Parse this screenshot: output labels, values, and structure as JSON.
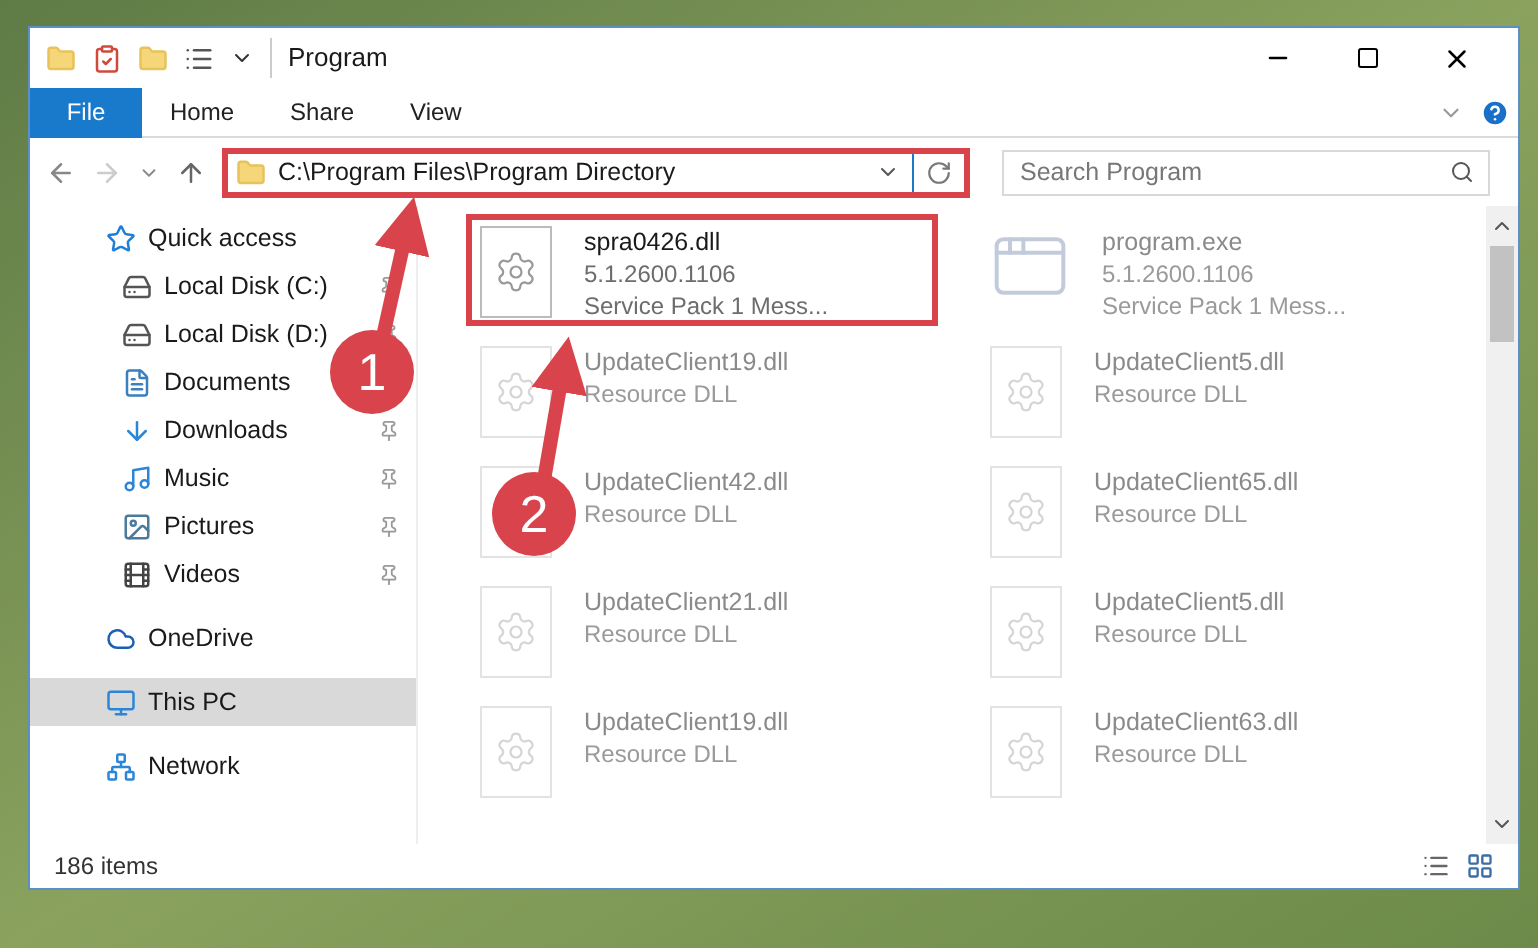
{
  "window": {
    "title": "Program"
  },
  "ribbon_tabs": [
    {
      "label": "File",
      "selected": true
    },
    {
      "label": "Home",
      "selected": false
    },
    {
      "label": "Share",
      "selected": false
    },
    {
      "label": "View",
      "selected": false
    }
  ],
  "address_bar": {
    "path": "C:\\Program Files\\Program Directory",
    "highlighted": true
  },
  "search": {
    "placeholder": "Search Program"
  },
  "navigation": [
    {
      "label": "Quick access",
      "kind": "star",
      "selected": false,
      "children": [
        {
          "label": "Local Disk (C:)",
          "kind": "drive-c",
          "pinned": true
        },
        {
          "label": "Local Disk (D:)",
          "kind": "drive",
          "pinned": true
        },
        {
          "label": "Documents",
          "kind": "documents"
        },
        {
          "label": "Downloads",
          "kind": "downloads",
          "pinned": true
        },
        {
          "label": "Music",
          "kind": "music",
          "pinned": true
        },
        {
          "label": "Pictures",
          "kind": "pictures",
          "pinned": true
        },
        {
          "label": "Videos",
          "kind": "videos",
          "pinned": true
        }
      ]
    },
    {
      "label": "OneDrive",
      "kind": "cloud",
      "selected": false
    },
    {
      "label": "This PC",
      "kind": "pc",
      "selected": true
    },
    {
      "label": "Network",
      "kind": "network",
      "selected": false
    }
  ],
  "files": [
    {
      "name": "spra0426.dll",
      "kind": "dll",
      "faded": false,
      "highlighted": true,
      "details": [
        "5.1.2600.1106",
        "Service Pack 1 Mess..."
      ]
    },
    {
      "name": "program.exe",
      "kind": "exe",
      "faded": true,
      "highlighted": false,
      "details": [
        "5.1.2600.1106",
        "Service Pack 1 Mess..."
      ]
    },
    {
      "name": "UpdateClient19.dll",
      "kind": "dll",
      "faded": true,
      "highlighted": false,
      "details": [
        "Resource DLL"
      ]
    },
    {
      "name": "UpdateClient5.dll",
      "kind": "dll",
      "faded": true,
      "highlighted": false,
      "details": [
        "Resource DLL"
      ]
    },
    {
      "name": "UpdateClient42.dll",
      "kind": "dll",
      "faded": true,
      "highlighted": false,
      "details": [
        "Resource DLL"
      ]
    },
    {
      "name": "UpdateClient65.dll",
      "kind": "dll",
      "faded": true,
      "highlighted": false,
      "details": [
        "Resource DLL"
      ]
    },
    {
      "name": "UpdateClient21.dll",
      "kind": "dll",
      "faded": true,
      "highlighted": false,
      "details": [
        "Resource DLL"
      ]
    },
    {
      "name": "UpdateClient5.dll",
      "kind": "dll",
      "faded": true,
      "highlighted": false,
      "details": [
        "Resource DLL"
      ]
    },
    {
      "name": "UpdateClient19.dll",
      "kind": "dll",
      "faded": true,
      "highlighted": false,
      "details": [
        "Resource DLL"
      ]
    },
    {
      "name": "UpdateClient63.dll",
      "kind": "dll",
      "faded": true,
      "highlighted": false,
      "details": [
        "Resource DLL"
      ]
    }
  ],
  "status_bar": {
    "item_count": "186 items"
  },
  "annotations": [
    {
      "label": "1"
    },
    {
      "label": "2"
    }
  ]
}
